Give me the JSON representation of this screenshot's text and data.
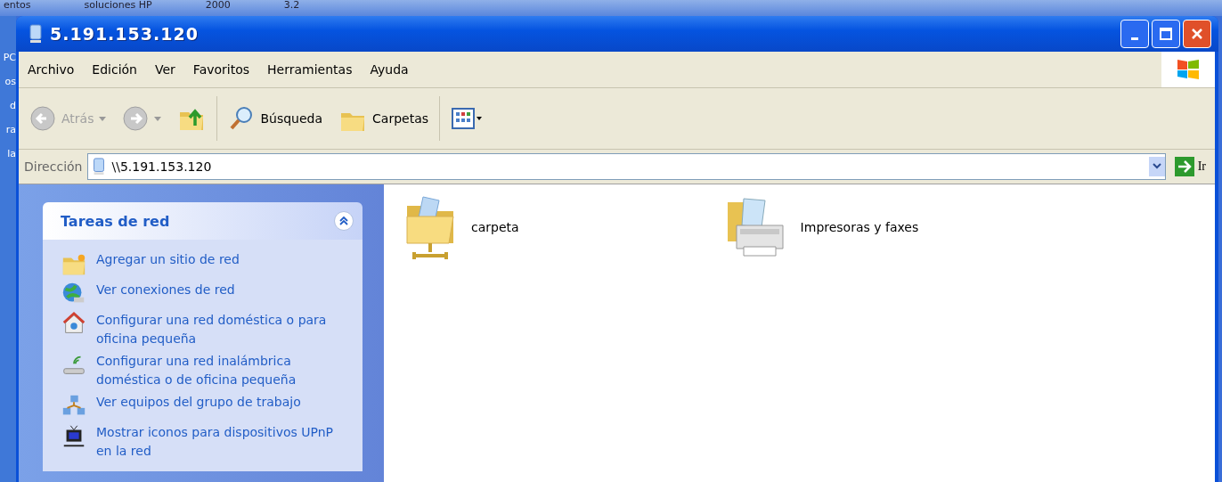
{
  "desktop": {
    "top_texts": [
      "entos",
      "soluciones HP",
      "2000",
      "3.2"
    ],
    "left_labels": [
      "PC",
      "os",
      "d",
      "ra",
      "la"
    ]
  },
  "window": {
    "title": "5.191.153.120"
  },
  "menu": [
    "Archivo",
    "Edición",
    "Ver",
    "Favoritos",
    "Herramientas",
    "Ayuda"
  ],
  "toolbar": [
    {
      "kind": "back",
      "label": "Atrás",
      "disabled": true
    },
    {
      "kind": "forward"
    },
    {
      "kind": "up"
    },
    {
      "kind": "search",
      "label": "Búsqueda"
    },
    {
      "kind": "folders",
      "label": "Carpetas"
    },
    {
      "kind": "views"
    }
  ],
  "address": {
    "label": "Dirección",
    "value": "\\\\5.191.153.120",
    "go": "Ir"
  },
  "sidebar": {
    "title": "Tareas de red",
    "expanded": true,
    "items": [
      {
        "kind": "add",
        "label": "Agregar un sitio de red"
      },
      {
        "kind": "globe",
        "label": "Ver conexiones de red"
      },
      {
        "kind": "home",
        "label": "Configurar una red doméstica o para oficina pequeña"
      },
      {
        "kind": "wireless",
        "label": "Configurar una red inalámbrica doméstica o de oficina pequeña"
      },
      {
        "kind": "group",
        "label": "Ver equipos del grupo de trabajo"
      },
      {
        "kind": "upnp",
        "label": "Mostrar iconos para dispositivos UPnP en la red"
      }
    ]
  },
  "items": [
    {
      "kind": "share",
      "label": "carpeta"
    },
    {
      "kind": "printers",
      "label": "Impresoras y faxes"
    }
  ]
}
